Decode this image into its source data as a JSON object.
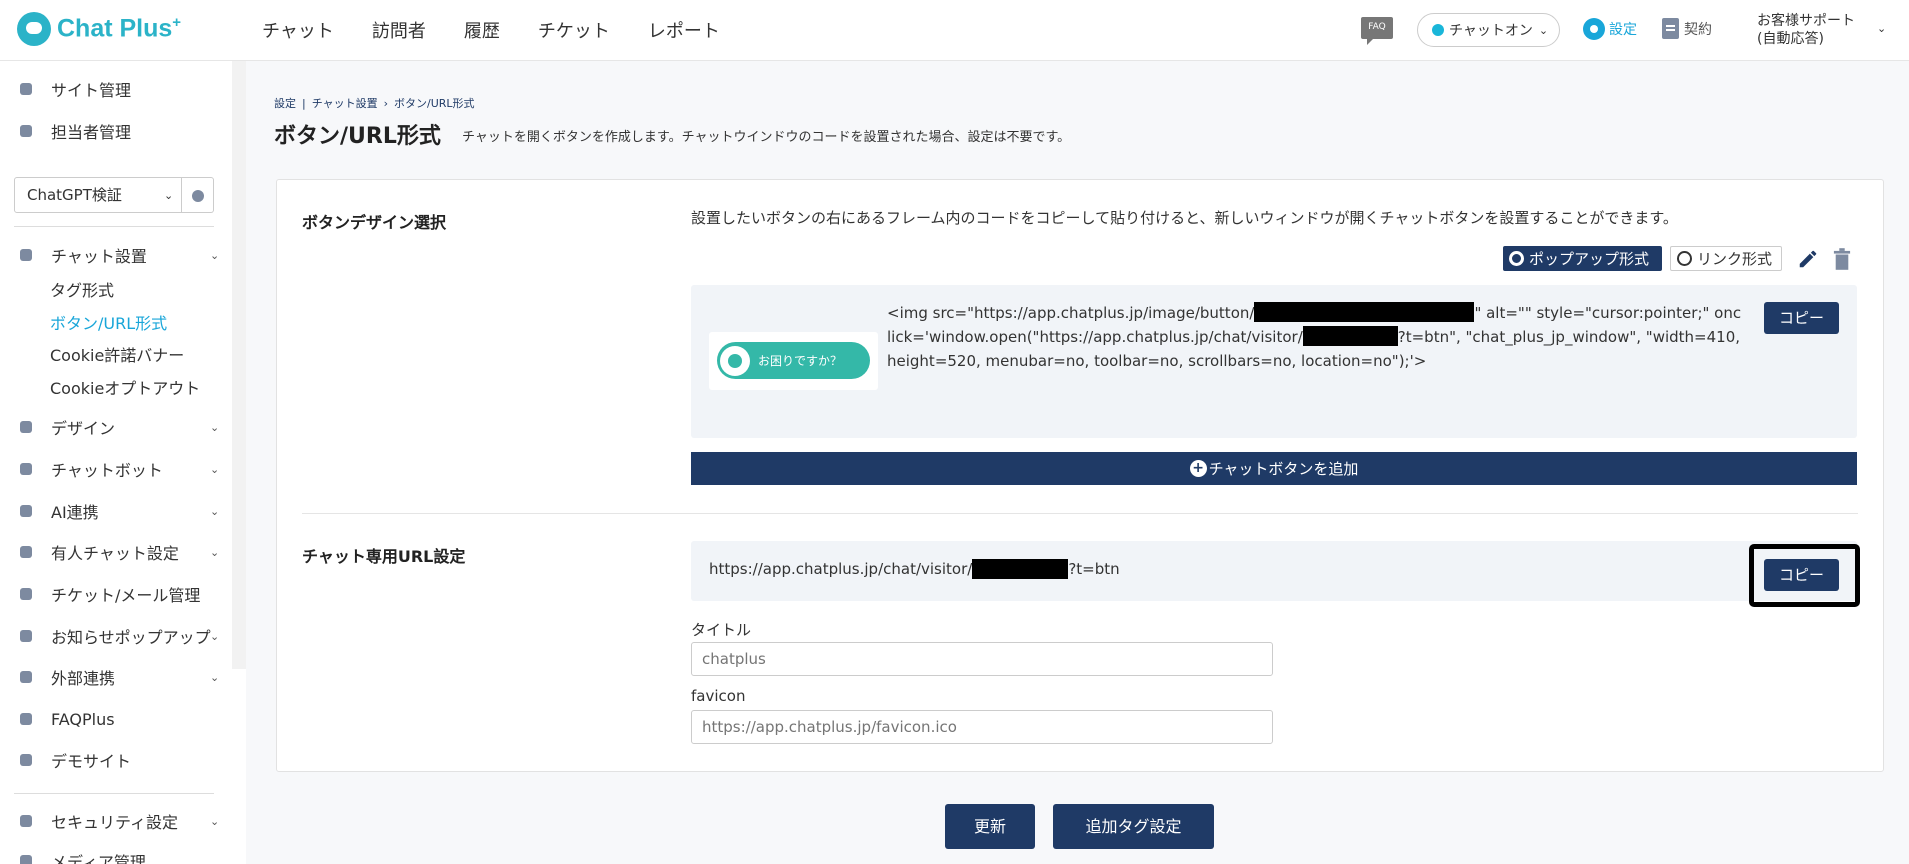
{
  "header": {
    "logo_text": "Chat Plus",
    "logo_sup": "+",
    "nav": [
      "チャット",
      "訪問者",
      "履歴",
      "チケット",
      "レポート"
    ],
    "faq_badge": "FAQ",
    "status_label": "チャットオン",
    "settings_label": "設定",
    "contract_label": "契約",
    "support_line1": "お客様サポート",
    "support_line2": "(自動応答)"
  },
  "sidebar": {
    "site_mgmt": "サイト管理",
    "staff_mgmt": "担当者管理",
    "site_select": "ChatGPT検証",
    "chat_settings": "チャット設置",
    "sub_items": [
      "タグ形式",
      "ボタン/URL形式",
      "Cookie許諾バナー",
      "Cookieオプトアウト"
    ],
    "design": "デザイン",
    "chatbot": "チャットボット",
    "ai": "AI連携",
    "manned": "有人チャット設定",
    "ticket_mail": "チケット/メール管理",
    "notice_popup": "お知らせポップアップ",
    "external": "外部連携",
    "faqplus": "FAQPlus",
    "demo": "デモサイト",
    "security": "セキュリティ設定",
    "media": "メディア管理"
  },
  "breadcrumb": [
    "設定",
    "|",
    "チャット設置",
    "›",
    "ボタン/URL形式"
  ],
  "page": {
    "title": "ボタン/URL形式",
    "description": "チャットを開くボタンを作成します。チャットウインドウのコードを設置された場合、設定は不要です。"
  },
  "button_design": {
    "label": "ボタンデザイン選択",
    "intro": "設置したいボタンの右にあるフレーム内のコードをコピーして貼り付けると、新しいウィンドウが開くチャットボタンを設置することができます。",
    "radio_popup": "ポップアップ形式",
    "radio_link": "リンク形式",
    "preview_label": "お困りですか？",
    "code_part1": "<img src=\"https://app.chatplus.jp/image/button/",
    "code_part2": "\" alt=\"\" style=\"cursor:pointer;\" onclick='window.open(\"https://app.chatplus.jp/chat/visitor/",
    "code_part3": "?t=btn\", \"chat_plus_jp_window\", \"width=410, height=520, menubar=no, toolbar=no, scrollbars=no, location=no\");'>",
    "copy_label": "コピー",
    "add_label": "チャットボタンを追加"
  },
  "chat_url": {
    "label": "チャット専用URL設定",
    "url_prefix": "https://app.chatplus.jp/chat/visitor/",
    "url_suffix": "?t=btn",
    "copy_label": "コピー",
    "title_label": "タイトル",
    "title_value": "chatplus",
    "favicon_label": "favicon",
    "favicon_value": "https://app.chatplus.jp/favicon.ico"
  },
  "footer": {
    "update_label": "更新",
    "add_tag_label": "追加タグ設定"
  },
  "colors": {
    "brand": "#2bb3c8",
    "navy": "#1f3a66",
    "link": "#19a6d9"
  }
}
